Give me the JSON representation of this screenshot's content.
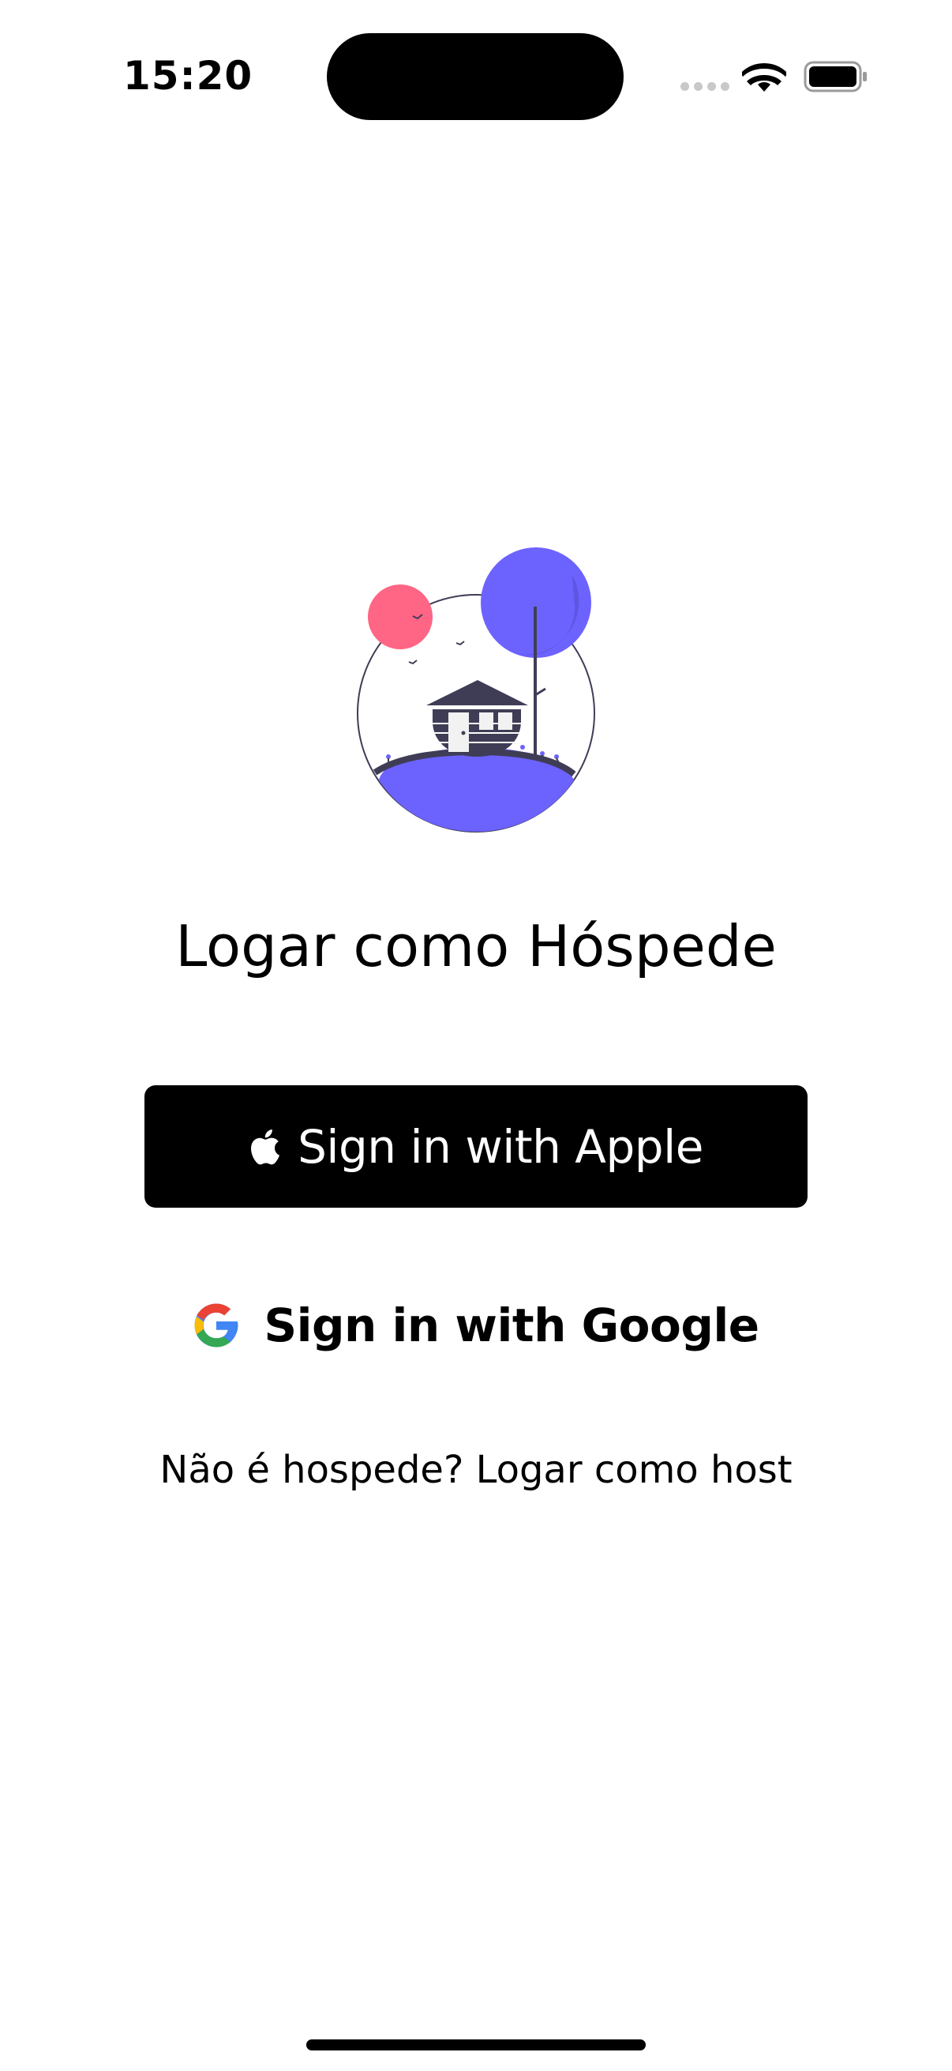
{
  "status_bar": {
    "time": "15:20"
  },
  "login": {
    "title": "Logar como Hóspede",
    "apple_button_label": "Sign in with Apple",
    "google_button_label": "Sign in with Google",
    "host_link_label": "Não é hospede? Logar como host"
  },
  "icons": {
    "apple": "apple-logo-icon",
    "google": "google-logo-icon",
    "wifi": "wifi-icon",
    "battery": "battery-icon"
  },
  "colors": {
    "accent_purple": "#6c63ff",
    "accent_pink": "#ff6584",
    "dark": "#3f3d56",
    "button_black": "#000000"
  }
}
